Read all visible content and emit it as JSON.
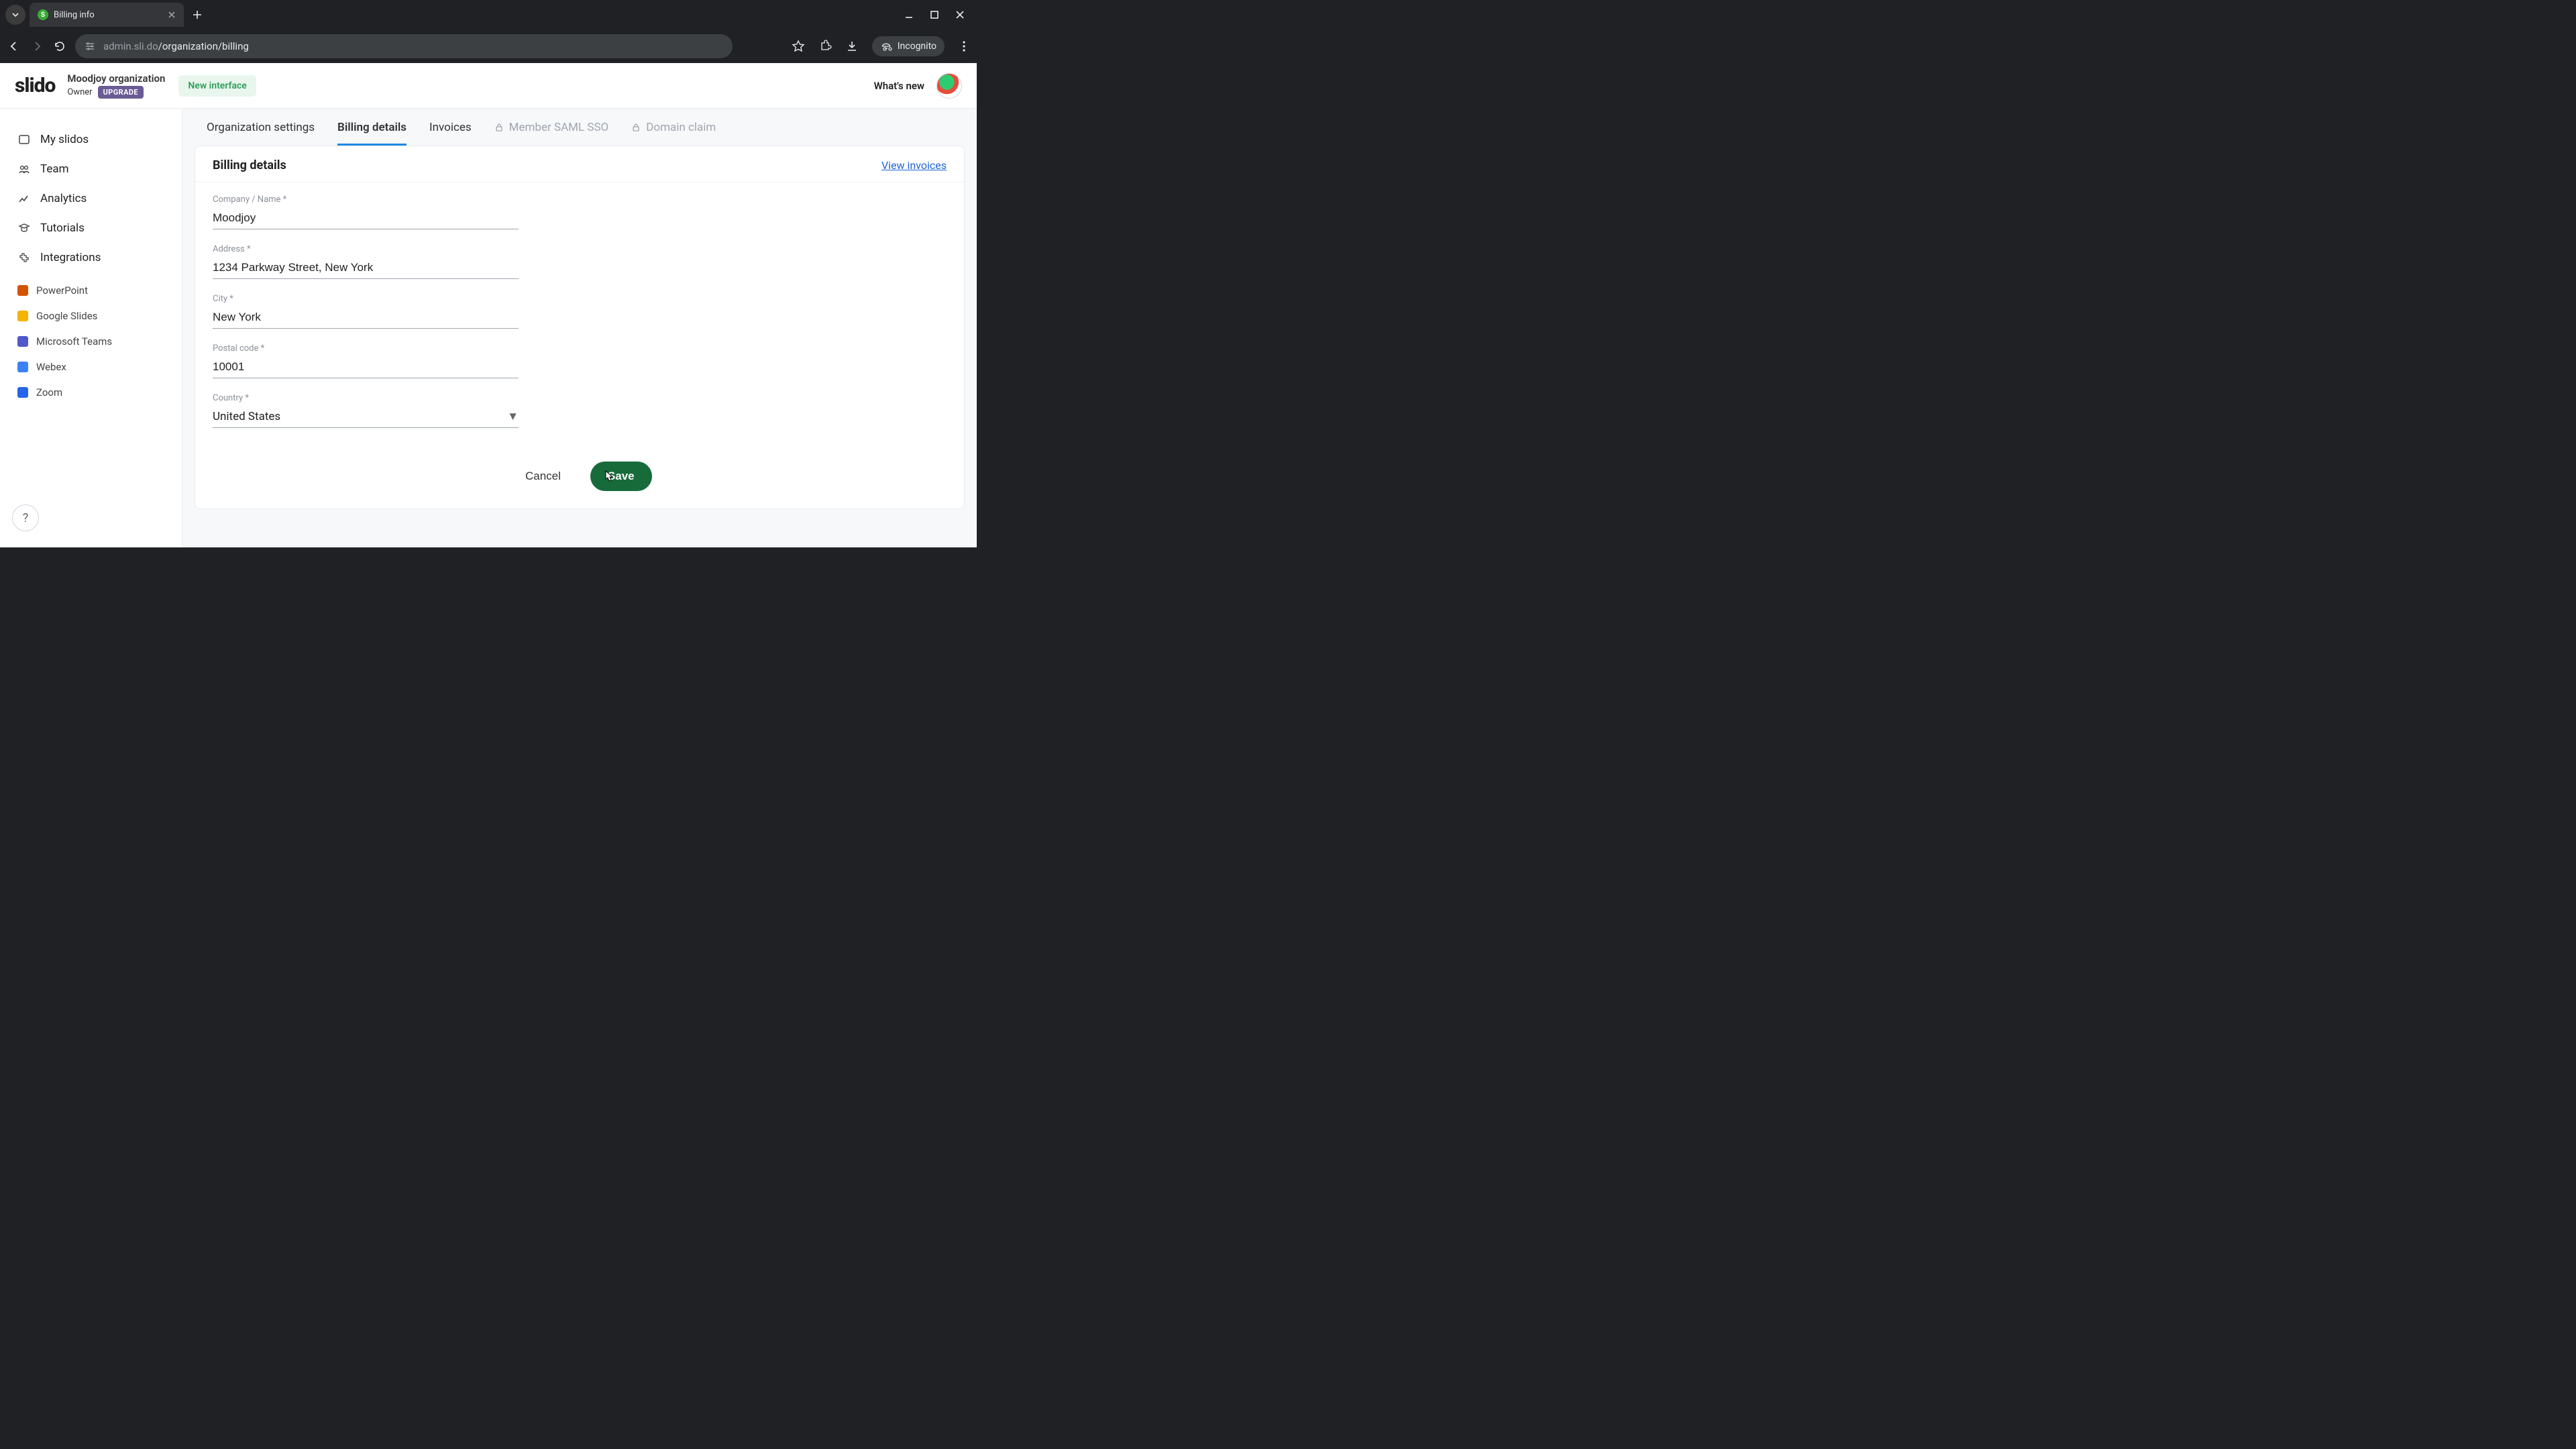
{
  "browser": {
    "tab_title": "Billing info",
    "url_display_muted": "admin.sli.do",
    "url_display_path": "/organization/billing",
    "incognito_label": "Incognito"
  },
  "header": {
    "logo_text": "slido",
    "org_name": "Moodjoy organization",
    "role_label": "Owner",
    "upgrade_label": "UPGRADE",
    "new_interface_label": "New interface",
    "whats_new_label": "What's new"
  },
  "sidebar": {
    "items": [
      {
        "label": "My slidos"
      },
      {
        "label": "Team"
      },
      {
        "label": "Analytics"
      },
      {
        "label": "Tutorials"
      },
      {
        "label": "Integrations"
      }
    ],
    "integrations": [
      {
        "label": "PowerPoint"
      },
      {
        "label": "Google Slides"
      },
      {
        "label": "Microsoft Teams"
      },
      {
        "label": "Webex"
      },
      {
        "label": "Zoom"
      }
    ],
    "help_label": "?"
  },
  "tabs": {
    "items": [
      {
        "label": "Organization settings",
        "active": false,
        "locked": false
      },
      {
        "label": "Billing details",
        "active": true,
        "locked": false
      },
      {
        "label": "Invoices",
        "active": false,
        "locked": false
      },
      {
        "label": "Member SAML SSO",
        "active": false,
        "locked": true
      },
      {
        "label": "Domain claim",
        "active": false,
        "locked": true
      }
    ]
  },
  "card": {
    "title": "Billing details",
    "view_invoices_label": "View invoices"
  },
  "form": {
    "company_label": "Company / Name *",
    "company_value": "Moodjoy",
    "address_label": "Address *",
    "address_value": "1234 Parkway Street, New York",
    "city_label": "City *",
    "city_value": "New York",
    "postal_label": "Postal code *",
    "postal_value": "10001",
    "country_label": "Country *",
    "country_value": "United States",
    "cancel_label": "Cancel",
    "save_label": "Save"
  }
}
